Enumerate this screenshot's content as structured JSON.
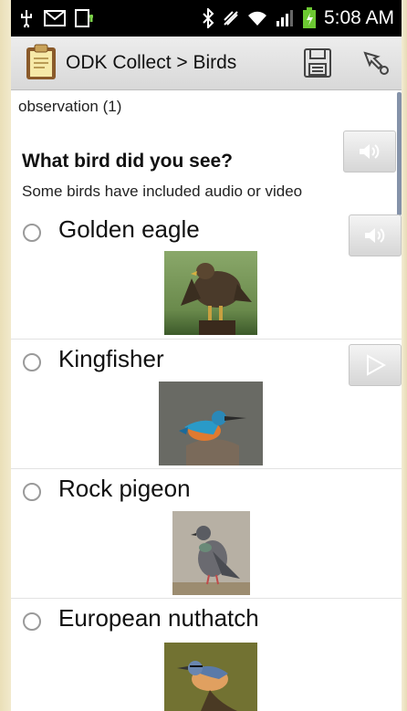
{
  "status_bar": {
    "time": "5:08 AM",
    "left_icons": [
      "usb-icon",
      "mail-icon",
      "download-icon"
    ],
    "right_icons": [
      "bluetooth-icon",
      "nfc-icon",
      "wifi-icon",
      "signal-icon",
      "battery-icon"
    ]
  },
  "action_bar": {
    "title": "ODK Collect > Birds",
    "icons": [
      "clipboard-icon",
      "save-icon",
      "navigation-icon"
    ]
  },
  "form": {
    "group_label": "observation (1)",
    "question": "What bird did you see?",
    "hint": "Some birds have included audio or video",
    "choices": [
      {
        "label": "Golden eagle",
        "media": "audio"
      },
      {
        "label": "Kingfisher",
        "media": "video"
      },
      {
        "label": "Rock pigeon",
        "media": ""
      },
      {
        "label": "European nuthatch",
        "media": ""
      }
    ]
  },
  "colors": {
    "status_bar": "#000000",
    "action_bar": "#e4e4e4",
    "background": "#ffffff",
    "border_frame": "#efe6c8"
  }
}
